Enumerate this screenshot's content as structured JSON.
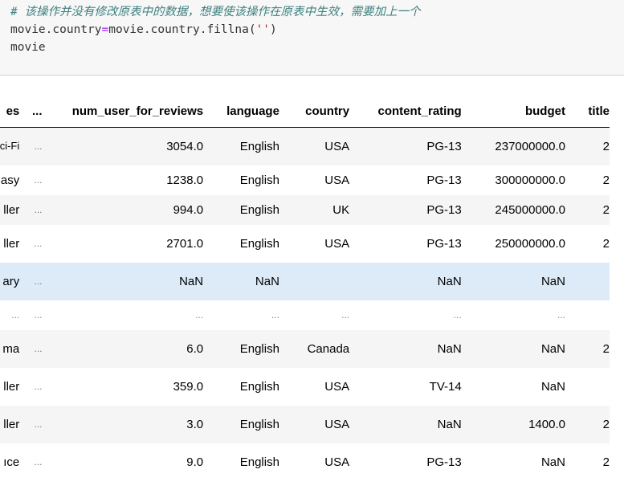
{
  "code_cell": {
    "comment": "# 该操作并没有修改原表中的数据，想要使该操作在原表中生效，需要加上一个",
    "line2": {
      "lhs": "movie.country",
      "op": "=",
      "call": "movie.country.fillna(",
      "arg": "''",
      "close": ")"
    },
    "line3": "movie"
  },
  "table": {
    "columns": [
      "es",
      "...",
      "num_user_for_reviews",
      "language",
      "country",
      "content_rating",
      "budget",
      "title"
    ],
    "rows": [
      {
        "genres": "Sci-Fi",
        "ellipsis": "...",
        "num_user_for_reviews": "3054.0",
        "language": "English",
        "country": "USA",
        "content_rating": "PG-13",
        "budget": "237000000.0",
        "title": "2",
        "style": "row-odd",
        "tall": true
      },
      {
        "genres": "asy",
        "ellipsis": "...",
        "num_user_for_reviews": "1238.0",
        "language": "English",
        "country": "USA",
        "content_rating": "PG-13",
        "budget": "300000000.0",
        "title": "2",
        "style": "row-even",
        "tall": false
      },
      {
        "genres": "ller",
        "ellipsis": "...",
        "num_user_for_reviews": "994.0",
        "language": "English",
        "country": "UK",
        "content_rating": "PG-13",
        "budget": "245000000.0",
        "title": "2",
        "style": "row-odd",
        "tall": false
      },
      {
        "genres": "ller",
        "ellipsis": "...",
        "num_user_for_reviews": "2701.0",
        "language": "English",
        "country": "USA",
        "content_rating": "PG-13",
        "budget": "250000000.0",
        "title": "2",
        "style": "row-even",
        "tall": true
      },
      {
        "genres": "ary",
        "ellipsis": "...",
        "num_user_for_reviews": "NaN",
        "language": "NaN",
        "country": "",
        "content_rating": "NaN",
        "budget": "NaN",
        "title": "",
        "style": "row-hover",
        "tall": true
      },
      {
        "genres": "...",
        "ellipsis": "...",
        "num_user_for_reviews": "...",
        "language": "...",
        "country": "...",
        "content_rating": "...",
        "budget": "...",
        "title": "",
        "style": "row-even row-ellipsis",
        "tall": false
      },
      {
        "genres": "ma",
        "ellipsis": "...",
        "num_user_for_reviews": "6.0",
        "language": "English",
        "country": "Canada",
        "content_rating": "NaN",
        "budget": "NaN",
        "title": "2",
        "style": "row-odd",
        "tall": true
      },
      {
        "genres": "ller",
        "ellipsis": "...",
        "num_user_for_reviews": "359.0",
        "language": "English",
        "country": "USA",
        "content_rating": "TV-14",
        "budget": "NaN",
        "title": "",
        "style": "row-even",
        "tall": true
      },
      {
        "genres": "ller",
        "ellipsis": "...",
        "num_user_for_reviews": "3.0",
        "language": "English",
        "country": "USA",
        "content_rating": "NaN",
        "budget": "1400.0",
        "title": "2",
        "style": "row-odd",
        "tall": true
      },
      {
        "genres": "ıce",
        "ellipsis": "...",
        "num_user_for_reviews": "9.0",
        "language": "English",
        "country": "USA",
        "content_rating": "PG-13",
        "budget": "NaN",
        "title": "2",
        "style": "row-even",
        "tall": true
      }
    ]
  }
}
